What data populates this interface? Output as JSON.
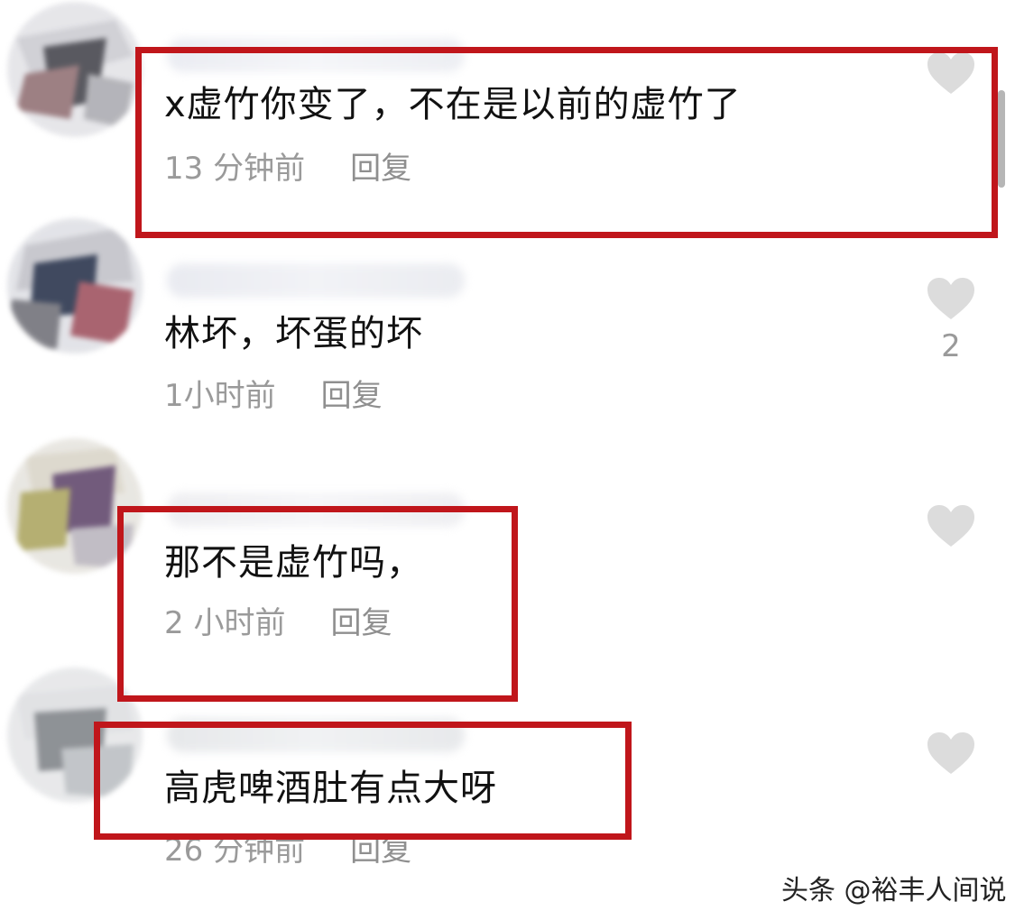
{
  "comments": [
    {
      "text": "x虚竹你变了，不在是以前的虚竹了",
      "time": "13 分钟前",
      "reply_label": "回复",
      "likes": null,
      "avatar_colors": [
        "#3d3d45",
        "#8d6a6e",
        "#c9c9cf"
      ],
      "highlighted": true
    },
    {
      "text": "林坏，坏蛋的坏",
      "time": "1小时前",
      "reply_label": "回复",
      "likes": "2",
      "avatar_colors": [
        "#1f2a44",
        "#9b4a58",
        "#bfbfc6"
      ],
      "highlighted": false
    },
    {
      "text": "那不是虚竹吗，",
      "time": "2 小时前",
      "reply_label": "回复",
      "likes": null,
      "avatar_colors": [
        "#5a3f66",
        "#a9a25a",
        "#d8d3c6"
      ],
      "highlighted": true
    },
    {
      "text": "高虎啤酒肚有点大呀",
      "time": "26 分钟前",
      "reply_label": "回复",
      "likes": null,
      "avatar_colors": [
        "#7b7f84",
        "#b8bcc0",
        "#dcdde0"
      ],
      "highlighted": true
    }
  ],
  "colors": {
    "highlight": "#c0161b",
    "like_icon": "#dcdcdc",
    "meta_text": "#9a9a9a"
  },
  "icons": {
    "like": "heart-icon"
  },
  "watermark": "头条 @裕丰人间说"
}
